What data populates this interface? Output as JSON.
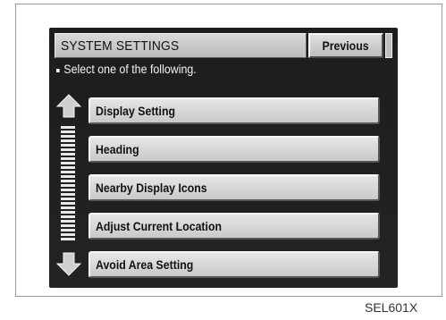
{
  "screen": {
    "title": "SYSTEM SETTINGS",
    "previous_label": "Previous",
    "instruction": "Select one of the following.",
    "menu_items": [
      {
        "label": "Display Setting"
      },
      {
        "label": "Heading"
      },
      {
        "label": "Nearby Display Icons"
      },
      {
        "label": "Adjust Current Location"
      },
      {
        "label": "Avoid Area Setting"
      }
    ],
    "scroll_up_icon": "arrow-up-icon",
    "scroll_down_icon": "arrow-down-icon"
  },
  "caption": "SEL601X",
  "colors": {
    "screen_bg": "#1f1f1f",
    "button_face": "#d4d4d4",
    "text_light": "#f2f2f2"
  }
}
